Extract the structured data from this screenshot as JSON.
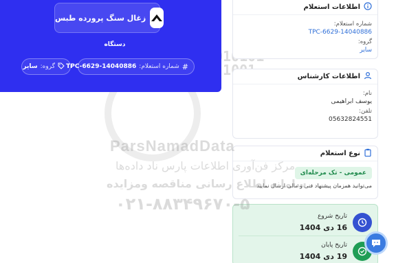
{
  "hero": {
    "title": "زغال سنگ پرورده طبس",
    "subtitle": "دستگاه",
    "tender_label": "شماره استعلام:",
    "tender_value": "TPC-6629-14040886",
    "group_label": "گروه:",
    "group_value": "سایر"
  },
  "inquiry_info": {
    "heading": "اطلاعات استعلام",
    "number_label": "شماره استعلام:",
    "number_value": "TPC-6629-14040886",
    "group_label": "گروه:",
    "group_value": "سایر"
  },
  "expert_info": {
    "heading": "اطلاعات کارشناس",
    "name_label": "نام:",
    "name_value": "یوسف ابراهیمی",
    "phone_label": "تلفن:",
    "phone_value": "05632824551"
  },
  "inquiry_type": {
    "heading": "نوع استعلام",
    "badge": "عمومی - تک مرحله‌ای",
    "description": "می‌توانید همزمان پیشنهاد فنی و مالی ارسال نمایید"
  },
  "dates": {
    "start_label": "تاریخ شروع",
    "start_value": "16 دی 1404",
    "end_label": "تاریخ پایان",
    "end_value": "19 دی 1404"
  },
  "watermark": {
    "brand": "ParsNamadData",
    "line1": "مرکز فن‌آوری اطلاعات پارس ناد داده‌ها",
    "line2": "سامانه اطلاع رسانی مناقصه ومزایده",
    "phone": "۰۲۱-۸۸۳۴۹۶۷۰-۵",
    "binary": "010101\n 1001\n  10\n   1"
  },
  "colors": {
    "hero_bg": "#2f2ff0",
    "accent_link": "#2f6fd8",
    "badge_bg": "#dff5e7",
    "badge_text": "#1f8a4c",
    "dates_bg": "#e3f5ea"
  }
}
